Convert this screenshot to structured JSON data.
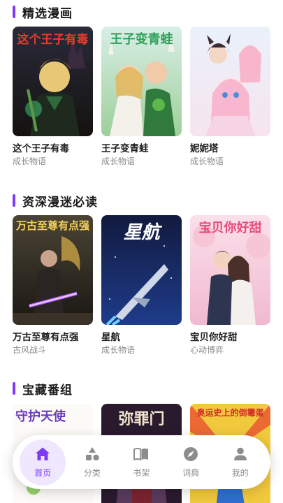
{
  "colors": {
    "accent": "#7d3cf3",
    "accent_soft": "#efe7fd",
    "nav_inactive": "#8d8d8d"
  },
  "sections": [
    {
      "title": "精选漫画",
      "items": [
        {
          "title": "这个王子有毒",
          "tag": "成长物语",
          "cover_text": "这个王子有毒"
        },
        {
          "title": "王子变青蛙",
          "tag": "成长物语",
          "cover_text": "王子变青蛙"
        },
        {
          "title": "妮妮塔",
          "tag": "成长物语",
          "cover_text": ""
        }
      ]
    },
    {
      "title": "资深漫迷必读",
      "items": [
        {
          "title": "万古至尊有点强",
          "tag": "古风战斗",
          "cover_text": "万古至尊有点强"
        },
        {
          "title": "星航",
          "tag": "成长物语",
          "cover_text": "星航"
        },
        {
          "title": "宝贝你好甜",
          "tag": "心动博弈",
          "cover_text": "宝贝你好甜"
        }
      ]
    },
    {
      "title": "宝藏番组",
      "items": [
        {
          "title": "",
          "tag": "",
          "cover_text": "守护天使"
        },
        {
          "title": "",
          "tag": "",
          "cover_text": "弥罪门"
        },
        {
          "title": "",
          "tag": "",
          "cover_text": "奥运史上的倒霉蛋"
        }
      ]
    }
  ],
  "nav": {
    "items": [
      {
        "label": "首页",
        "icon": "home-icon",
        "active": true
      },
      {
        "label": "分类",
        "icon": "category-icon",
        "active": false
      },
      {
        "label": "书架",
        "icon": "bookshelf-icon",
        "active": false
      },
      {
        "label": "词典",
        "icon": "compass-icon",
        "active": false
      },
      {
        "label": "我的",
        "icon": "profile-icon",
        "active": false
      }
    ]
  }
}
